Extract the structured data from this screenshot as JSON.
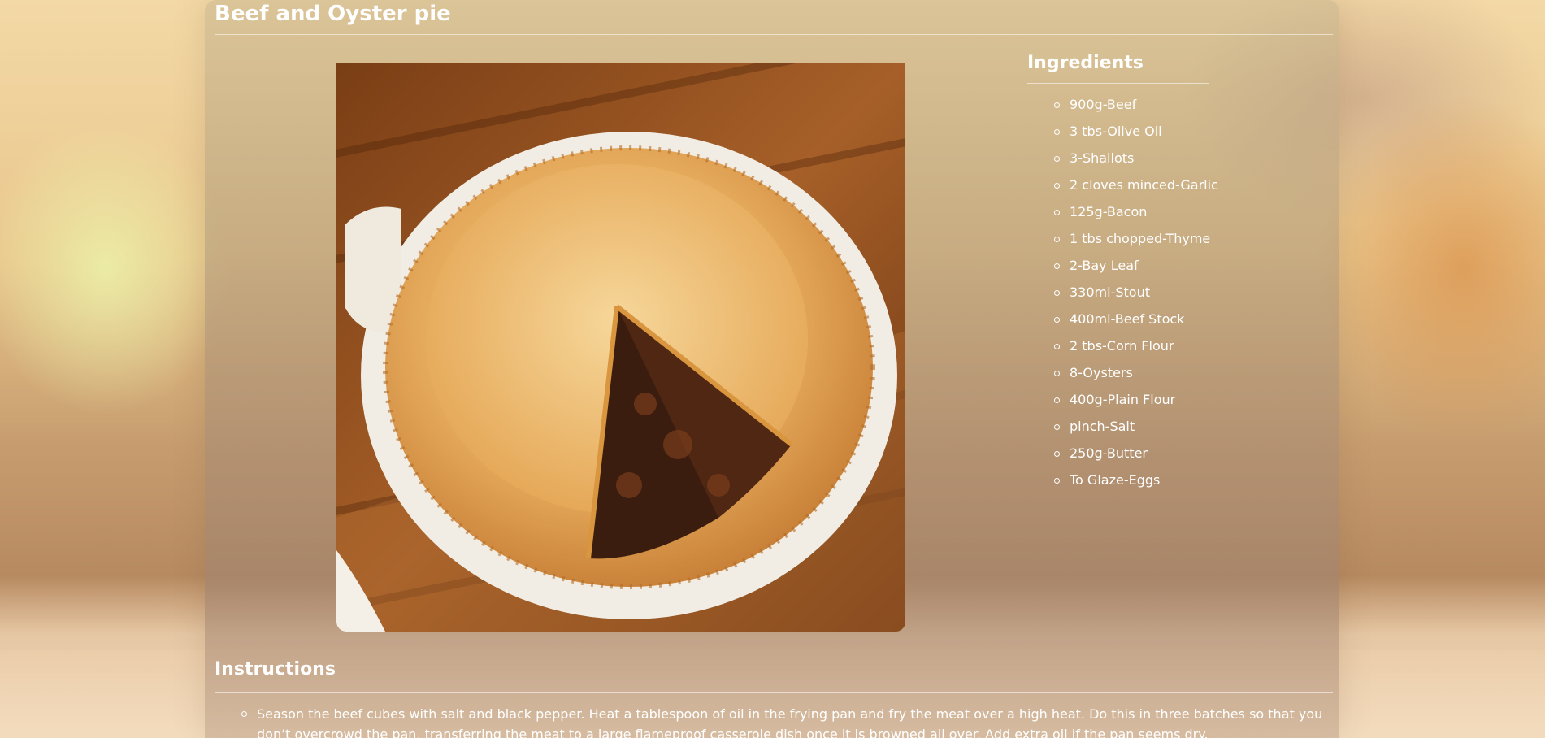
{
  "recipe": {
    "title": "Beef and Oyster pie",
    "image_subject": "beef-and-oyster-pie-photo"
  },
  "ingredients": {
    "heading": "Ingredients",
    "items": [
      "900g-Beef",
      "3 tbs-Olive Oil",
      "3-Shallots",
      "2 cloves minced-Garlic",
      "125g-Bacon",
      "1 tbs chopped-Thyme",
      "2-Bay Leaf",
      "330ml-Stout",
      "400ml-Beef Stock",
      "2 tbs-Corn Flour",
      "8-Oysters",
      "400g-Plain Flour",
      "pinch-Salt",
      "250g-Butter",
      "To Glaze-Eggs"
    ]
  },
  "instructions": {
    "heading": "Instructions",
    "steps": [
      "Season the beef cubes with salt and black pepper. Heat a tablespoon of oil in the frying pan and fry the meat over a high heat. Do this in three batches so that you don’t overcrowd the pan, transferring the meat to a large flameproof casserole dish once it is browned all over. Add extra oil if the pan seems dry."
    ]
  },
  "colors": {
    "text": "#ffffff",
    "card_tint": "#b8a07e"
  }
}
